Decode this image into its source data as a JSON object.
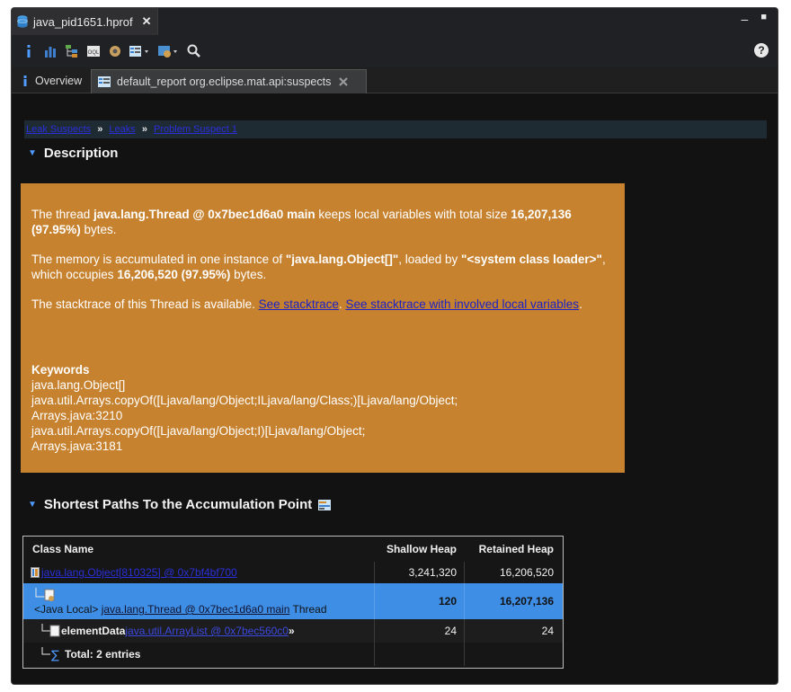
{
  "file_tab": {
    "title": "java_pid1651.hprof",
    "close": "✕"
  },
  "window_controls": {
    "minimize": "–",
    "maximize": "■"
  },
  "toolbar": {
    "help": "?"
  },
  "tabs": [
    {
      "label": "Overview"
    },
    {
      "label": "default_report  org.eclipse.mat.api:suspects"
    }
  ],
  "breadcrumb": {
    "items": [
      "Leak Suspects",
      "Leaks",
      "Problem Suspect 1"
    ],
    "separator": "»"
  },
  "description": {
    "heading": "Description",
    "p1_pre": "The thread ",
    "p1_bold": "java.lang.Thread @ 0x7bec1d6a0 main",
    "p1_mid": " keeps local variables with total size ",
    "p1_size": "16,207,136 (97.95%)",
    "p1_post": " bytes.",
    "p2_pre": "The memory is accumulated in one instance of ",
    "p2_obj": "\"java.lang.Object[]\"",
    "p2_mid": ", loaded by ",
    "p2_loader": "\"<system class loader>\"",
    "p2_mid2": ", which occupies ",
    "p2_size": "16,206,520 (97.95%)",
    "p2_post": " bytes.",
    "p3_pre": "The stacktrace of this Thread is available. ",
    "p3_link1": "See stacktrace",
    "p3_sep": ". ",
    "p3_link2": "See stacktrace with involved local variables",
    "p3_post": ".",
    "keywords_title": "Keywords",
    "keywords": [
      "java.lang.Object[]",
      "java.util.Arrays.copyOf([Ljava/lang/Object;ILjava/lang/Class;)[Ljava/lang/Object;",
      "Arrays.java:3210",
      "java.util.Arrays.copyOf([Ljava/lang/Object;I)[Ljava/lang/Object;",
      "Arrays.java:3181"
    ]
  },
  "paths": {
    "heading": "Shortest Paths To the Accumulation Point",
    "columns": [
      "Class Name",
      "Shallow Heap",
      "Retained Heap"
    ],
    "rows": [
      {
        "name": "java.lang.Object[810325] @ 0x7bf4bf700",
        "shallow": "3,241,320",
        "retained": "16,206,520"
      },
      {
        "prefix": "<Java Local> ",
        "name": "java.lang.Thread @ 0x7bec1d6a0 main",
        "suffix": " Thread",
        "shallow": "120",
        "retained": "16,207,136"
      },
      {
        "field": "elementData ",
        "name": "java.util.ArrayList @ 0x7bec560c0",
        "suffix": " »",
        "shallow": "24",
        "retained": "24"
      }
    ],
    "total": "Total: 2 entries"
  }
}
